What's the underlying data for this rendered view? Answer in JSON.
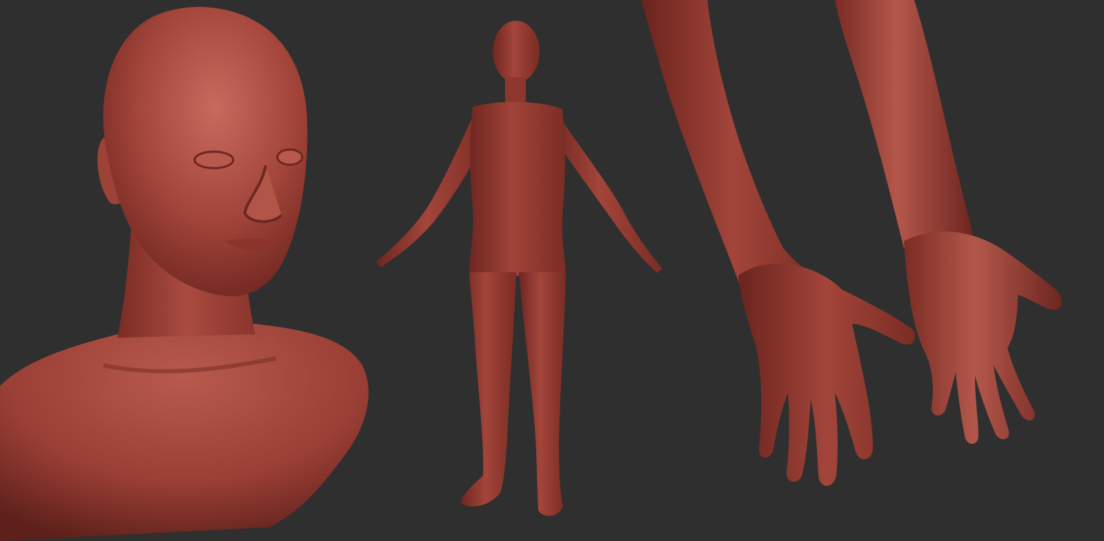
{
  "scene": {
    "background_color": "#2f2f2f",
    "clay_color": "#a3453a",
    "clay_highlight": "#c4655a",
    "clay_shadow": "#6e2620",
    "views": [
      {
        "name": "head-bust-closeup"
      },
      {
        "name": "full-body-a-pose"
      },
      {
        "name": "forearms-and-hands-closeup"
      }
    ]
  }
}
